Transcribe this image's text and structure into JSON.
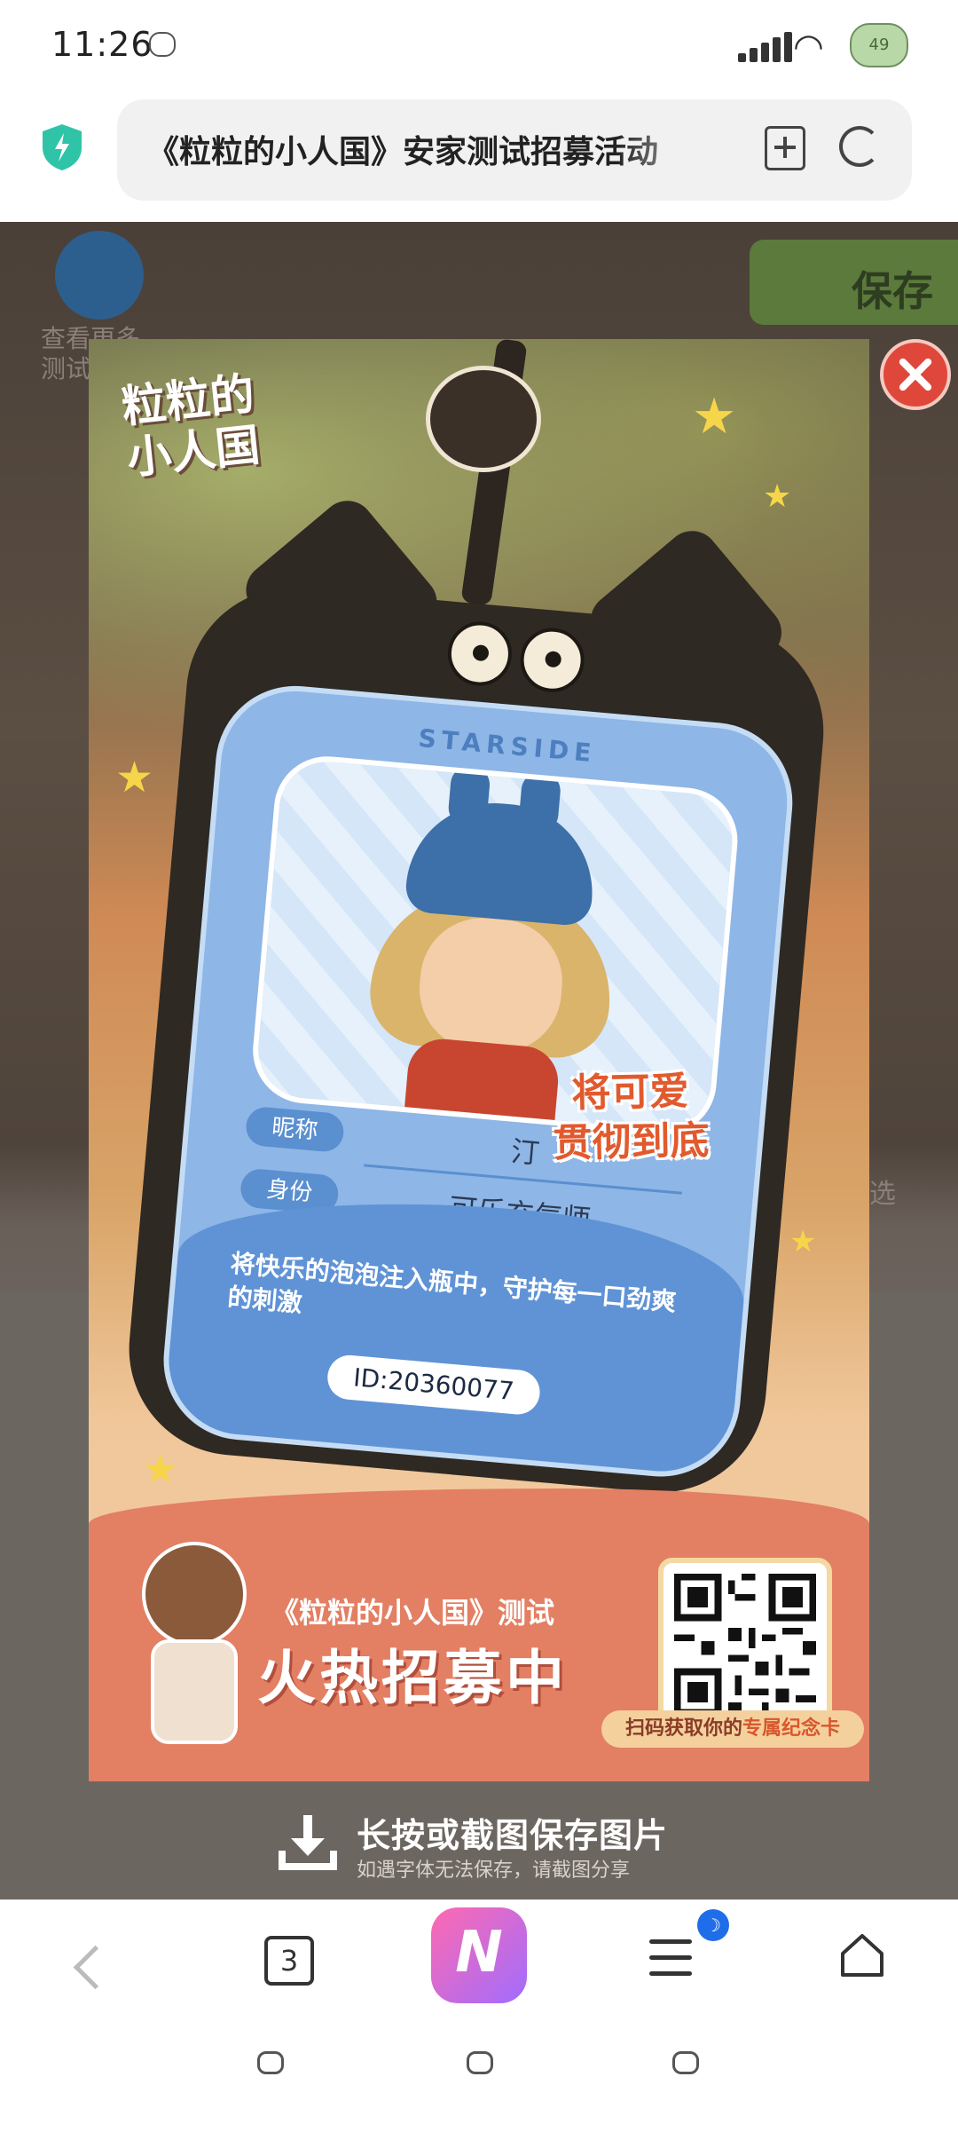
{
  "status_bar": {
    "time": "11:26",
    "battery": "49"
  },
  "browser": {
    "url_title": "《粒粒的小人国》安家测试招募活动",
    "shield_color": "#2fc4a8"
  },
  "background_page": {
    "back_label": "查看更多\n测试",
    "save_label": "保存",
    "right_text": "选"
  },
  "poster": {
    "logo": "粒粒的\n小人国",
    "brand": "STARSIDE",
    "slogan": "将可爱\n贯彻到底",
    "fields": [
      {
        "label": "昵称",
        "value": "汀"
      },
      {
        "label": "身份",
        "value": "可乐充气师"
      }
    ],
    "motto": "将快乐的泡泡注入瓶中，守护每一口劲爽的刺激",
    "id": "ID:20360077",
    "recruit_sub": "《粒粒的小人国》测试",
    "recruit_main": "火热招募中",
    "qr_caption_prefix": "扫码获取你的",
    "qr_caption_highlight": "专属纪念卡"
  },
  "save_hint": {
    "main": "长按或截图保存图片",
    "sub": "如遇字体无法保存，请截图分享"
  },
  "nav_bar": {
    "tab_count": "3",
    "menu_badge": "☽"
  }
}
